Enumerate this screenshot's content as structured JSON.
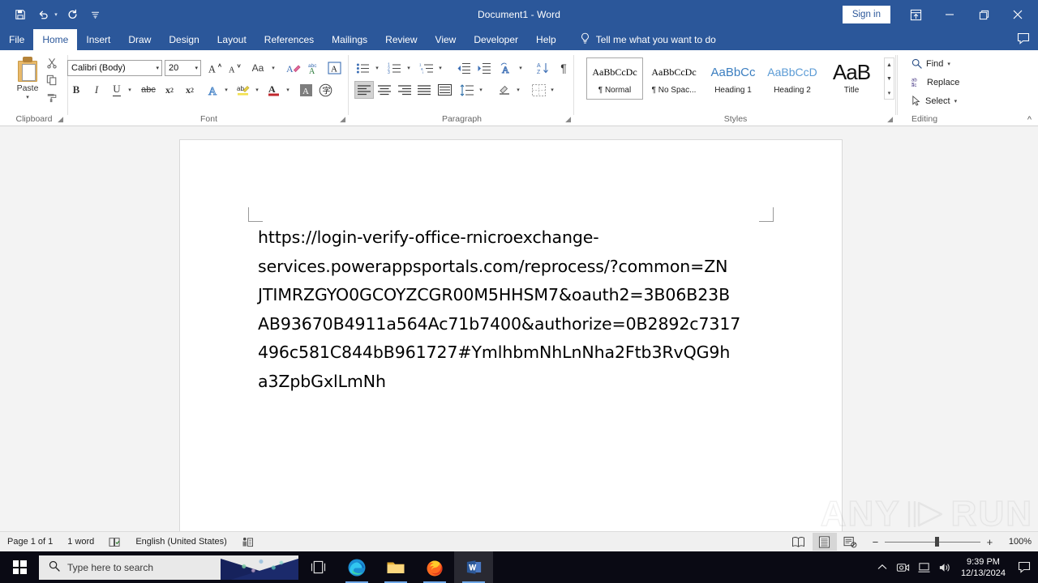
{
  "titlebar": {
    "document_title": "Document1  -  Word",
    "signin_label": "Sign in",
    "quick_access": [
      {
        "name": "save-icon",
        "glyph": "💾"
      },
      {
        "name": "undo-icon",
        "glyph": "↶"
      },
      {
        "name": "redo-icon",
        "glyph": "↻"
      },
      {
        "name": "customize-qat-icon",
        "glyph": "☰"
      }
    ],
    "window_controls": {
      "ribbon_display_options": "⤒",
      "minimize": "─",
      "restore": "❐",
      "close": "✕"
    }
  },
  "ribbon": {
    "tabs": [
      {
        "label": "File",
        "active": false
      },
      {
        "label": "Home",
        "active": true
      },
      {
        "label": "Insert",
        "active": false
      },
      {
        "label": "Draw",
        "active": false
      },
      {
        "label": "Design",
        "active": false
      },
      {
        "label": "Layout",
        "active": false
      },
      {
        "label": "References",
        "active": false
      },
      {
        "label": "Mailings",
        "active": false
      },
      {
        "label": "Review",
        "active": false
      },
      {
        "label": "View",
        "active": false
      },
      {
        "label": "Developer",
        "active": false
      },
      {
        "label": "Help",
        "active": false
      }
    ],
    "tell_me": "Tell me what you want to do",
    "groups": {
      "clipboard": {
        "label": "Clipboard",
        "paste_label": "Paste",
        "buttons": [
          "Cut",
          "Copy",
          "Format Painter"
        ]
      },
      "font": {
        "label": "Font",
        "font_name": "Calibri (Body)",
        "font_size": "20",
        "buttons": [
          "Grow Font",
          "Shrink Font",
          "Change Case",
          "Clear All Formatting",
          "Phonetic Guide",
          "Character Border",
          "Bold",
          "Italic",
          "Underline",
          "Strikethrough",
          "Subscript",
          "Superscript",
          "Text Effects and Typography",
          "Text Highlight Color",
          "Font Color",
          "Character Shading",
          "Enclose Characters"
        ]
      },
      "paragraph": {
        "label": "Paragraph",
        "buttons": [
          "Bullets",
          "Numbering",
          "Multilevel List",
          "Decrease Indent",
          "Increase Indent",
          "Asian Layout",
          "Sort",
          "Show/Hide Formatting Marks",
          "Align Left",
          "Center",
          "Align Right",
          "Justify",
          "Distributed",
          "Line and Paragraph Spacing",
          "Shading",
          "Borders"
        ]
      },
      "styles": {
        "label": "Styles",
        "items": [
          {
            "preview": "AaBbCcDc",
            "name": "¶ Normal",
            "selected": true
          },
          {
            "preview": "AaBbCcDc",
            "name": "¶ No Spac...",
            "selected": false
          },
          {
            "preview": "AaBbCc",
            "name": "Heading 1",
            "selected": false
          },
          {
            "preview": "AaBbCcD",
            "name": "Heading 2",
            "selected": false
          },
          {
            "preview": "AaB",
            "name": "Title",
            "selected": false
          }
        ]
      },
      "editing": {
        "label": "Editing",
        "find": "Find",
        "replace": "Replace",
        "select": "Select"
      }
    }
  },
  "document": {
    "lines": [
      "https://login-verify-office-rnicroexchange-",
      "services.powerappsportals.com/reprocess/?common=ZN",
      "JTIMRZGYO0GCOYZCGR00M5HHSM7&oauth2=3B06B23B",
      "AB93670B4911a564Ac71b7400&authorize=0B2892c7317",
      "496c581C844bB961727#YmlhbmNhLnNha2Ftb3RvQG9h",
      "a3ZpbGxlLmNh"
    ],
    "watermark": {
      "left": "ANY",
      "right": "RUN"
    }
  },
  "statusbar": {
    "page": "Page 1 of 1",
    "words": "1 word",
    "proofing_icon": "proofing-errors-icon",
    "language": "English (United States)",
    "accessibility_icon": "accessibility-checker-icon",
    "views": [
      {
        "name": "read-mode-view",
        "glyph": "📖",
        "active": false
      },
      {
        "name": "print-layout-view",
        "glyph": "☰",
        "active": true
      },
      {
        "name": "web-layout-view",
        "glyph": "🗔",
        "active": false
      }
    ],
    "zoom_out": "−",
    "zoom_in": "+",
    "zoom_value": "100%"
  },
  "taskbar": {
    "search_placeholder": "Type here to search",
    "apps": [
      {
        "name": "task-view-button",
        "label": "Task View"
      },
      {
        "name": "taskbar-app-edge",
        "label": "Microsoft Edge"
      },
      {
        "name": "taskbar-app-file-explorer",
        "label": "File Explorer"
      },
      {
        "name": "taskbar-app-firefox",
        "label": "Mozilla Firefox"
      },
      {
        "name": "taskbar-app-word",
        "label": "Microsoft Word"
      }
    ],
    "tray": [
      {
        "name": "show-hidden-icons",
        "glyph": "∧"
      },
      {
        "name": "webcam-icon",
        "glyph": "📷"
      },
      {
        "name": "network-icon",
        "glyph": "🖥"
      },
      {
        "name": "volume-icon",
        "glyph": "🔊"
      }
    ],
    "time": "9:39 PM",
    "date": "12/13/2024",
    "notification_icon": "action-center-icon"
  },
  "colors": {
    "word_blue": "#2b579a",
    "taskbar": "#0a0a14",
    "page_bg": "#f3f3f3"
  }
}
